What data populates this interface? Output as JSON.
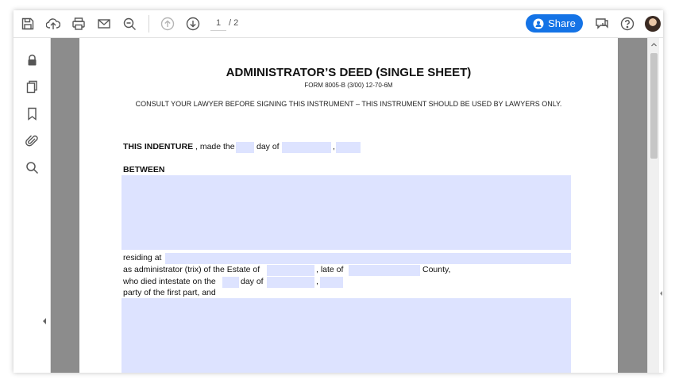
{
  "toolbar": {
    "icons": [
      "save-icon",
      "upload-icon",
      "print-icon",
      "email-icon",
      "zoom-search-icon",
      "page-up-icon",
      "page-down-icon"
    ],
    "page_current": "1",
    "page_total": "/ 2",
    "share_label": "Share",
    "right_icons": [
      "comment-icon",
      "help-icon",
      "avatar"
    ]
  },
  "left_rail": {
    "icons": [
      "lock-icon",
      "pages-icon",
      "bookmark-icon",
      "attachment-icon",
      "search-icon"
    ]
  },
  "colors": {
    "accent": "#1473e6",
    "field_fill": "#dde3ff",
    "viewer_background": "#8c8c8c"
  },
  "document": {
    "title": "ADMINISTRATOR’S DEED (SINGLE SHEET)",
    "form_code": "FORM 8005-B (3/00) 12-70-6M",
    "consult_notice": "CONSULT YOUR LAWYER BEFORE SIGNING THIS INSTRUMENT – THIS INSTRUMENT SHOULD BE USED BY LAWYERS ONLY.",
    "indenture_bold": "THIS INDENTURE",
    "indenture_made": ", made the",
    "day_of": "day of",
    "comma": ",",
    "between": "BETWEEN",
    "residing_at": "residing at",
    "administrator_text": "as administrator (trix) of the Estate of",
    "late_of": ", late of",
    "county": "County,",
    "died_intestate": "who died intestate on the",
    "day_of_2": "day of",
    "comma_2": ",",
    "party_first": "party of the first part, and"
  }
}
